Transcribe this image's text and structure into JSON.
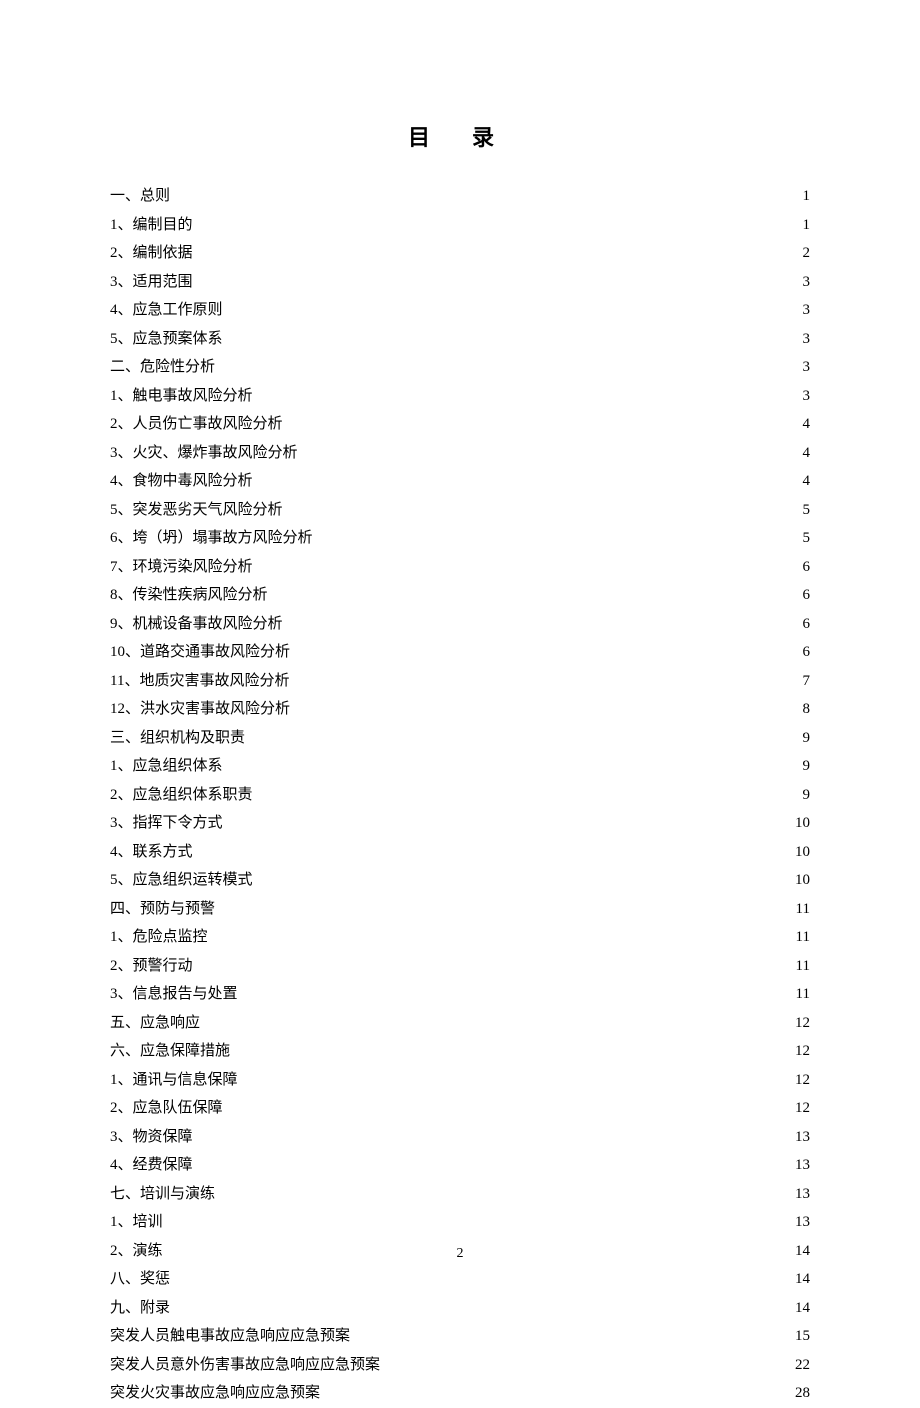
{
  "title": "目 录",
  "page_number": "2",
  "toc": [
    {
      "label": "一、总则",
      "page": "1"
    },
    {
      "label": "1、编制目的",
      "page": "1"
    },
    {
      "label": "2、编制依据",
      "page": "2"
    },
    {
      "label": "3、适用范围",
      "page": "3"
    },
    {
      "label": "4、应急工作原则",
      "page": "3"
    },
    {
      "label": "5、应急预案体系",
      "page": "3"
    },
    {
      "label": "二、危险性分析",
      "page": "3"
    },
    {
      "label": "1、触电事故风险分析",
      "page": "3"
    },
    {
      "label": "2、人员伤亡事故风险分析",
      "page": "4"
    },
    {
      "label": "3、火灾、爆炸事故风险分析",
      "page": "4"
    },
    {
      "label": "4、食物中毒风险分析",
      "page": "4"
    },
    {
      "label": "5、突发恶劣天气风险分析",
      "page": "5"
    },
    {
      "label": "6、垮（坍）塌事故方风险分析",
      "page": "5"
    },
    {
      "label": "7、环境污染风险分析",
      "page": "6"
    },
    {
      "label": "8、传染性疾病风险分析",
      "page": "6"
    },
    {
      "label": "9、机械设备事故风险分析",
      "page": "6"
    },
    {
      "label": "10、道路交通事故风险分析",
      "page": "6"
    },
    {
      "label": "11、地质灾害事故风险分析",
      "page": "7"
    },
    {
      "label": "12、洪水灾害事故风险分析",
      "page": "8"
    },
    {
      "label": "三、组织机构及职责",
      "page": "9"
    },
    {
      "label": "1、应急组织体系",
      "page": "9"
    },
    {
      "label": "2、应急组织体系职责",
      "page": "9"
    },
    {
      "label": "3、指挥下令方式",
      "page": "10"
    },
    {
      "label": "4、联系方式",
      "page": "10"
    },
    {
      "label": "5、应急组织运转模式",
      "page": "10"
    },
    {
      "label": "四、预防与预警",
      "page": "11"
    },
    {
      "label": "1、危险点监控",
      "page": "11"
    },
    {
      "label": "2、预警行动",
      "page": "11"
    },
    {
      "label": "3、信息报告与处置",
      "page": "11"
    },
    {
      "label": "五、应急响应",
      "page": "12"
    },
    {
      "label": "六、应急保障措施",
      "page": "12"
    },
    {
      "label": "1、通讯与信息保障",
      "page": "12"
    },
    {
      "label": "2、应急队伍保障",
      "page": "12"
    },
    {
      "label": "3、物资保障",
      "page": "13"
    },
    {
      "label": "4、经费保障",
      "page": "13"
    },
    {
      "label": "七、培训与演练",
      "page": "13"
    },
    {
      "label": "1、培训",
      "page": "13"
    },
    {
      "label": "2、演练",
      "page": "14"
    },
    {
      "label": "八、奖惩",
      "page": "14"
    },
    {
      "label": "九、附录",
      "page": "14"
    },
    {
      "label": "突发人员触电事故应急响应应急预案",
      "page": "15"
    },
    {
      "label": "突发人员意外伤害事故应急响应应急预案",
      "page": "22"
    },
    {
      "label": "突发火灾事故应急响应应急预案",
      "page": "28"
    }
  ]
}
